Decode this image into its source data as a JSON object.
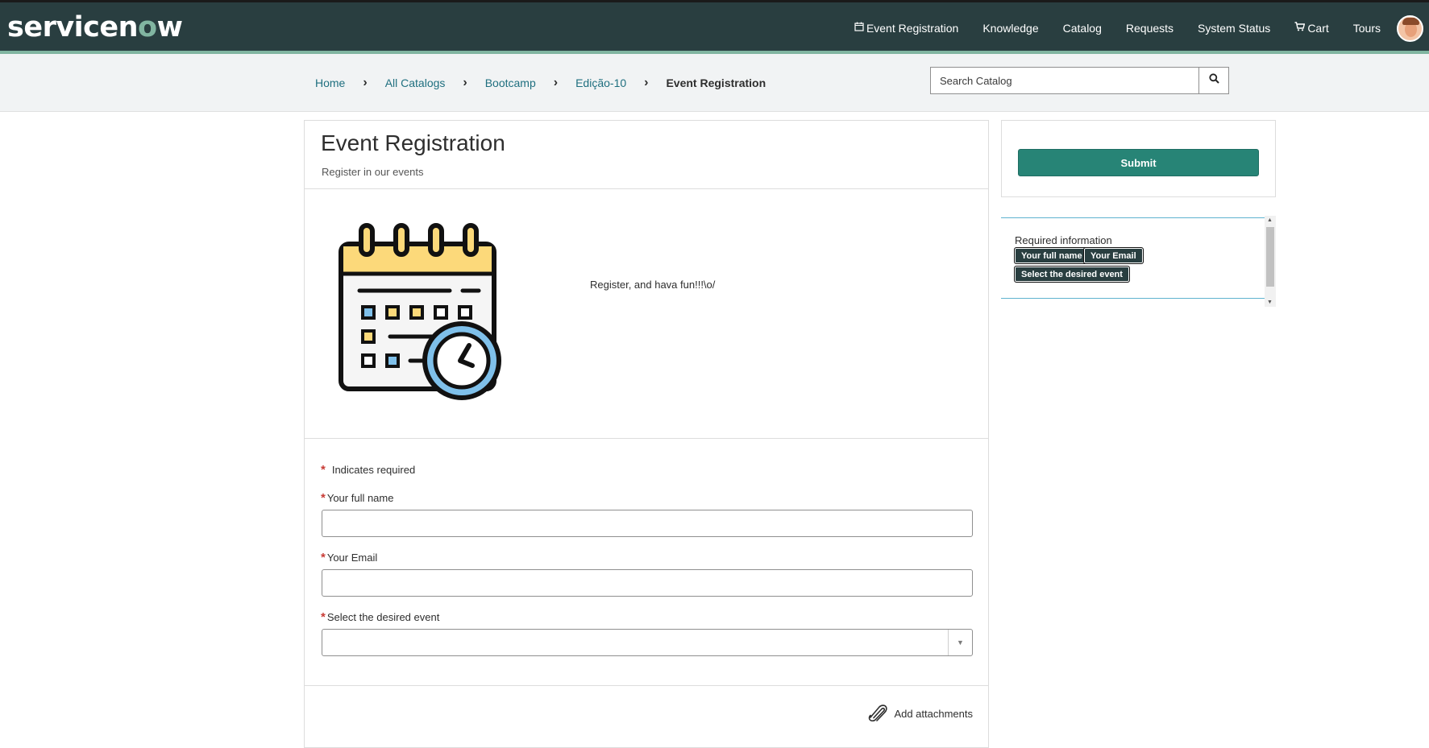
{
  "header": {
    "logo_pre": "servicen",
    "logo_o": "o",
    "logo_post": "w",
    "nav": [
      {
        "label": "Event Registration",
        "icon": "calendar-icon"
      },
      {
        "label": "Knowledge"
      },
      {
        "label": "Catalog"
      },
      {
        "label": "Requests"
      },
      {
        "label": "System Status"
      },
      {
        "label": "Cart",
        "icon": "cart-icon"
      },
      {
        "label": "Tours"
      }
    ]
  },
  "breadcrumb": {
    "items": [
      "Home",
      "All Catalogs",
      "Bootcamp",
      "Edição-10"
    ],
    "current": "Event Registration"
  },
  "search": {
    "placeholder": "Search Catalog"
  },
  "item": {
    "title": "Event Registration",
    "subtitle": "Register in our events",
    "description": "Register, and hava fun!!!\\o/"
  },
  "form": {
    "required_note": "Indicates required",
    "required_marker": "*",
    "fields": [
      {
        "label": "Your full name",
        "value": ""
      },
      {
        "label": "Your Email",
        "value": ""
      },
      {
        "label": "Select the desired event",
        "value": ""
      }
    ],
    "add_attachments": "Add attachments"
  },
  "side": {
    "submit_label": "Submit",
    "required_title": "Required information",
    "required_badges": [
      "Your full name",
      "Your Email",
      "Select the desired event"
    ]
  },
  "colors": {
    "header_bg": "#293e40",
    "accent": "#81b5a1",
    "submit": "#278476",
    "required": "#c83c36",
    "link": "#1f6f7f"
  }
}
